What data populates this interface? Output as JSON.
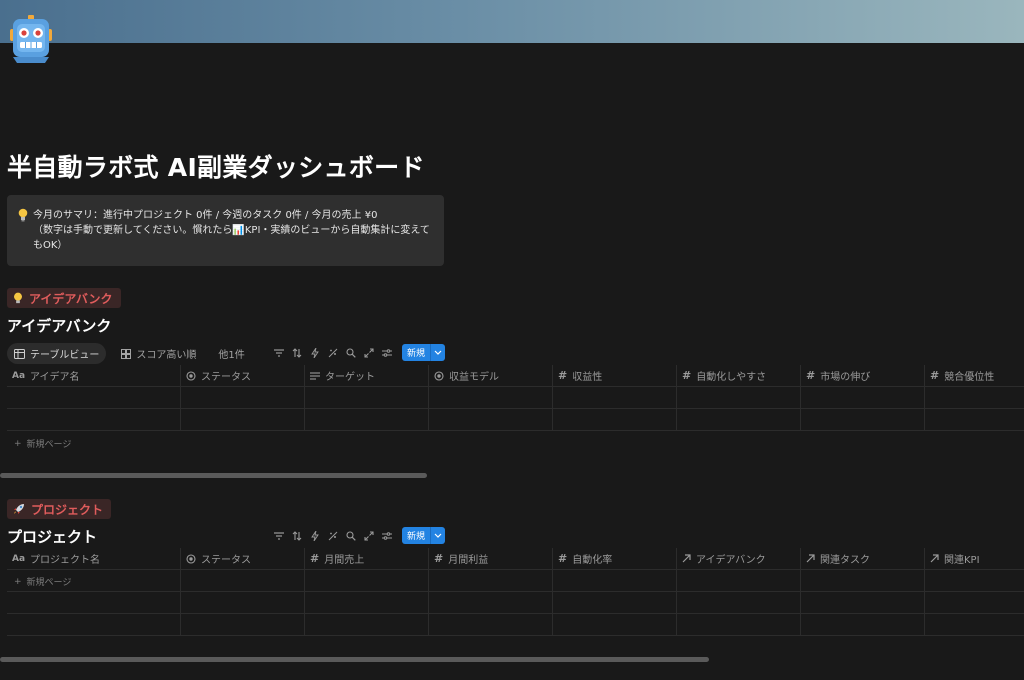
{
  "page": {
    "title": "半自動ラボ式 AI副業ダッシュボード",
    "icon": "robot-face-icon",
    "colors": {
      "background": "#191919",
      "accent": "#2383e2",
      "section_red": "#e05c5c"
    }
  },
  "callout": {
    "icon": "lightbulb-icon",
    "line1": "今月のサマリ：進行中プロジェクト 0件 / 今週のタスク 0件 / 今月の売上 ¥0",
    "line2": "（数字は手動で更新してください。慣れたら📊KPI・実績のビューから自動集計に変えて",
    "line3": "もOK）"
  },
  "ideas": {
    "badge_label": "アイデアバンク",
    "badge_icon": "lightbulb-icon",
    "db_title": "アイデアバンク",
    "views": [
      {
        "label": "テーブルビュー",
        "icon": "table-icon"
      },
      {
        "label": "スコア高い順",
        "icon": "grid-icon"
      },
      {
        "label": "他1件"
      }
    ],
    "new_button": "新規",
    "columns": [
      {
        "label": "アイデア名",
        "icon": "Aa"
      },
      {
        "label": "ステータス",
        "icon": "status-icon"
      },
      {
        "label": "ターゲット",
        "icon": "text-icon"
      },
      {
        "label": "収益モデル",
        "icon": "status-icon"
      },
      {
        "label": "収益性",
        "icon": "#"
      },
      {
        "label": "自動化しやすさ",
        "icon": "#"
      },
      {
        "label": "市場の伸び",
        "icon": "#"
      },
      {
        "label": "競合優位性",
        "icon": "#"
      }
    ],
    "new_page": "新規ページ"
  },
  "projects": {
    "badge_label": "プロジェクト",
    "badge_icon": "rocket-icon",
    "db_title": "プロジェクト",
    "new_button": "新規",
    "columns": [
      {
        "label": "プロジェクト名",
        "icon": "Aa"
      },
      {
        "label": "ステータス",
        "icon": "status-icon"
      },
      {
        "label": "月間売上",
        "icon": "#"
      },
      {
        "label": "月間利益",
        "icon": "#"
      },
      {
        "label": "自動化率",
        "icon": "#"
      },
      {
        "label": "アイデアバンク",
        "icon": "relation-icon"
      },
      {
        "label": "関連タスク",
        "icon": "relation-icon"
      },
      {
        "label": "関連KPI",
        "icon": "relation-icon"
      }
    ],
    "new_page": "新規ページ"
  }
}
